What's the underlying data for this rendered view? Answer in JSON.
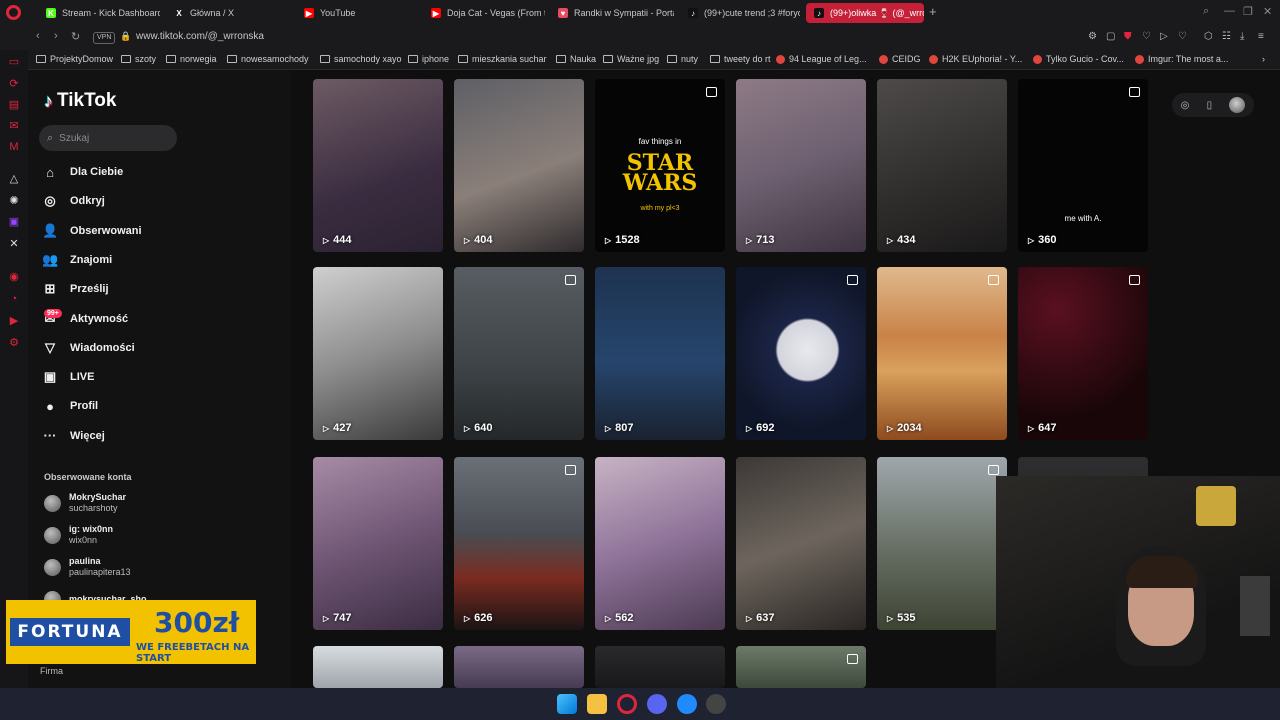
{
  "browser": {
    "tabs": [
      {
        "label": "Stream - Kick Dashboard",
        "fav_color": "#53fc18",
        "glyph": "K"
      },
      {
        "label": "Główna / X",
        "fav_color": "#1a1a1d",
        "glyph": "X"
      },
      {
        "label": "YouTube",
        "fav_color": "#ff0000",
        "glyph": "▶"
      },
      {
        "label": "Doja Cat - Vegas (From th",
        "fav_color": "#ff0000",
        "glyph": "▶"
      },
      {
        "label": "Randki w Sympatii - Porta",
        "fav_color": "#e84a5f",
        "glyph": "♥"
      },
      {
        "label": "(99+)cute trend ;3 #foryo",
        "fav_color": "#111",
        "glyph": "♪"
      },
      {
        "label": "(99+)oliwka 🍷 (@_wrron",
        "fav_color": "#111",
        "glyph": "♪"
      }
    ],
    "new_tab": "+",
    "vpn": "VPN",
    "url": "www.tiktok.com/@_wrronska",
    "bookmarks": [
      {
        "label": "ProjektyDomow",
        "type": "folder"
      },
      {
        "label": "szoty",
        "type": "folder"
      },
      {
        "label": "norwegia",
        "type": "folder"
      },
      {
        "label": "nowesamochody",
        "type": "folder"
      },
      {
        "label": "samochody xayo",
        "type": "folder"
      },
      {
        "label": "iphone",
        "type": "folder"
      },
      {
        "label": "mieszkania suchar",
        "type": "folder"
      },
      {
        "label": "Nauka",
        "type": "folder"
      },
      {
        "label": "Ważne jpg",
        "type": "folder"
      },
      {
        "label": "nuty",
        "type": "folder"
      },
      {
        "label": "tweety do rt",
        "type": "folder"
      },
      {
        "label": "94 League of Leg...",
        "type": "site"
      },
      {
        "label": "CEIDG",
        "type": "site"
      },
      {
        "label": "H2K EUphoria! - Y...",
        "type": "site"
      },
      {
        "label": "Tylko Gucio - Cov...",
        "type": "site"
      },
      {
        "label": "Imgur: The most a...",
        "type": "site"
      }
    ]
  },
  "tiktok": {
    "logo": "TikTok",
    "search_placeholder": "Szukaj",
    "nav": [
      {
        "label": "Dla Ciebie",
        "icon": "home-icon",
        "glyph": "⌂"
      },
      {
        "label": "Odkryj",
        "icon": "compass-icon",
        "glyph": "◎"
      },
      {
        "label": "Obserwowani",
        "icon": "following-icon",
        "glyph": "👤"
      },
      {
        "label": "Znajomi",
        "icon": "friends-icon",
        "glyph": "👥"
      },
      {
        "label": "Prześlij",
        "icon": "upload-icon",
        "glyph": "⊞"
      },
      {
        "label": "Aktywność",
        "icon": "activity-icon",
        "glyph": "✉"
      },
      {
        "label": "Wiadomości",
        "icon": "messages-icon",
        "glyph": "▽"
      },
      {
        "label": "LIVE",
        "icon": "live-icon",
        "glyph": "▣"
      },
      {
        "label": "Profil",
        "icon": "profile-icon",
        "glyph": "●"
      },
      {
        "label": "Więcej",
        "icon": "more-icon",
        "glyph": "···"
      }
    ],
    "activity_badge": "99+",
    "followed_header": "Obserwowane konta",
    "followed": [
      {
        "name": "MokrySuchar",
        "handle": "sucharshoty"
      },
      {
        "name": "ig: wix0nn",
        "handle": "wix0nn"
      },
      {
        "name": "paulina",
        "handle": "paulinapitera13"
      },
      {
        "name": "mokrysuchar_sho...",
        "handle": ""
      }
    ],
    "footer_label": "Firma",
    "videos": [
      {
        "views": "444",
        "multi": false,
        "caption": "",
        "bg": "linear-gradient(160deg,#6d5a63,#3a2c40 60%,#2a2230)"
      },
      {
        "views": "404",
        "multi": false,
        "caption": "",
        "bg": "linear-gradient(160deg,#5e5f66,#8a7f79 55%,#2f2b2d)"
      },
      {
        "views": "1528",
        "multi": true,
        "caption": "fav things in",
        "caption2": "STAR WARS",
        "caption3": "with my pl<3",
        "bg": "#050505"
      },
      {
        "views": "713",
        "multi": false,
        "caption": "",
        "bg": "linear-gradient(160deg,#8e7a86,#6d6070 50%,#3e3340)"
      },
      {
        "views": "434",
        "multi": false,
        "caption": "",
        "bg": "linear-gradient(160deg,#4d4a49,#2e2c2b 60%,#1a1919)"
      },
      {
        "views": "360",
        "multi": true,
        "caption": "me with A.",
        "bg": "#050505"
      },
      {
        "views": "427",
        "multi": false,
        "caption": "",
        "bg": "linear-gradient(160deg,#cfcfcf,#8d8d8d 50%,#3a3a3a)"
      },
      {
        "views": "640",
        "multi": true,
        "caption": "",
        "bg": "linear-gradient(180deg,#575d62,#3d4246 60%,#24282a)"
      },
      {
        "views": "807",
        "multi": false,
        "caption": "",
        "bg": "linear-gradient(180deg,#1d3350,#26456d 55%,#1a2230)"
      },
      {
        "views": "692",
        "multi": true,
        "caption": "",
        "bg": "radial-gradient(circle at 55% 48%,#e8e8ee 0,#d4d4dc 26%,#1b2445 28%,#0f1629 70%)"
      },
      {
        "views": "2034",
        "multi": true,
        "caption": "",
        "bg": "linear-gradient(180deg,#e0b98c,#c98248 40%,#d9a15c 60%,#8e4b1f)"
      },
      {
        "views": "647",
        "multi": true,
        "caption": "",
        "bg": "radial-gradient(circle at 30% 25%,#5a1020,#180608 70%)"
      },
      {
        "views": "747",
        "multi": false,
        "caption": "",
        "bg": "linear-gradient(160deg,#a78ba6,#6f5674 50%,#3b2c42)"
      },
      {
        "views": "626",
        "multi": true,
        "caption": "",
        "bg": "linear-gradient(180deg,#6a7077,#494c52 45%,#7a2b20 70%,#1c1414)"
      },
      {
        "views": "562",
        "multi": false,
        "caption": "",
        "bg": "linear-gradient(160deg,#c7b3c4,#8f7399 50%,#4b3a52)"
      },
      {
        "views": "637",
        "multi": false,
        "caption": "",
        "bg": "linear-gradient(160deg,#3c3836,#6d655d 50%,#2a2624)"
      },
      {
        "views": "535",
        "multi": true,
        "caption": "",
        "bg": "linear-gradient(180deg,#9fa7ad,#6a7268 50%,#3d4434)"
      },
      {
        "views": "",
        "multi": false,
        "caption": "",
        "bg": "linear-gradient(180deg,#2e2e30,#1a1a1c)"
      },
      {
        "views": "",
        "multi": false,
        "caption": "",
        "bg": "linear-gradient(180deg,#d8dce0,#9ea5ab)"
      },
      {
        "views": "",
        "multi": false,
        "caption": "",
        "bg": "linear-gradient(180deg,#7b6a86,#463b52)"
      },
      {
        "views": "",
        "multi": false,
        "caption": "",
        "bg": "linear-gradient(180deg,#2a2a2c,#18181a)"
      },
      {
        "views": "",
        "multi": true,
        "caption": "",
        "bg": "linear-gradient(180deg,#6d7a6a,#3d4a3b)"
      }
    ]
  },
  "ad": {
    "brand": "FORTUNA",
    "amount": "300zł",
    "promo": "WE FREEBETACH NA START"
  }
}
